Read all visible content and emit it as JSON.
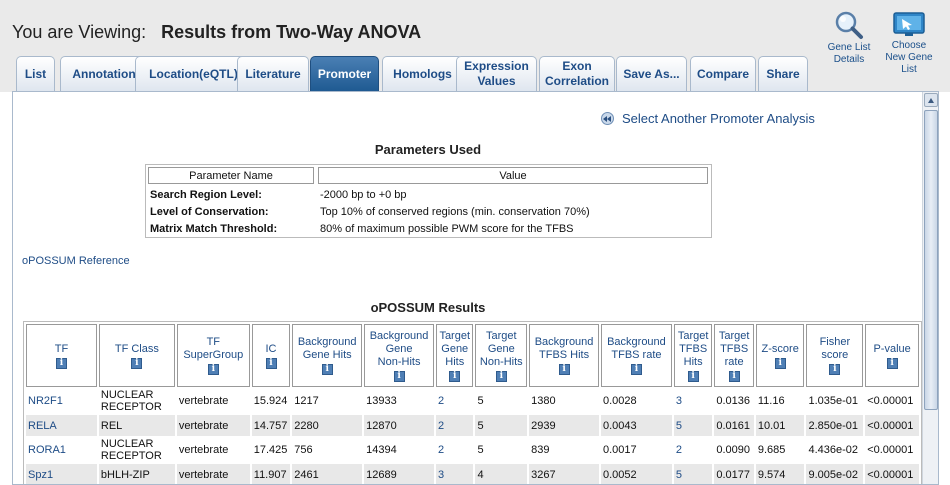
{
  "header": {
    "viewing_label": "You are Viewing:",
    "viewing_title": "Results from Two-Way ANOVA",
    "gene_list_details": [
      "Gene List",
      "Details"
    ],
    "choose_new_list": [
      "Choose",
      "New Gene",
      "List"
    ]
  },
  "tabs": [
    {
      "label": "List",
      "lines": [
        "List"
      ],
      "active": false
    },
    {
      "label": "Annotation",
      "lines": [
        "Annotation"
      ],
      "active": false
    },
    {
      "label": "Location(eQTL)",
      "lines": [
        "Location(eQTL)"
      ],
      "active": false
    },
    {
      "label": "Literature",
      "lines": [
        "Literature"
      ],
      "active": false
    },
    {
      "label": "Promoter",
      "lines": [
        "Promoter"
      ],
      "active": true
    },
    {
      "label": "Homologs",
      "lines": [
        "Homologs"
      ],
      "active": false
    },
    {
      "label": "Expression Values",
      "lines": [
        "Expression",
        "Values"
      ],
      "active": false
    },
    {
      "label": "Exon Correlation",
      "lines": [
        "Exon",
        "Correlation"
      ],
      "active": false
    },
    {
      "label": "Save As...",
      "lines": [
        "Save As..."
      ],
      "active": false
    },
    {
      "label": "Compare",
      "lines": [
        "Compare"
      ],
      "active": false
    },
    {
      "label": "Share",
      "lines": [
        "Share"
      ],
      "active": false
    }
  ],
  "select_another": "Select Another Promoter Analysis",
  "parameters": {
    "title": "Parameters Used",
    "col_name": "Parameter Name",
    "col_value": "Value",
    "rows": [
      {
        "name": "Search Region Level:",
        "value": "-2000 bp to +0 bp"
      },
      {
        "name": "Level of Conservation:",
        "value": "Top 10% of conserved regions (min. conservation 70%)"
      },
      {
        "name": "Matrix Match Threshold:",
        "value": "80% of maximum possible PWM score for the TFBS"
      }
    ]
  },
  "opossum_reference": "oPOSSUM Reference",
  "results": {
    "title": "oPOSSUM Results",
    "columns": [
      [
        "TF"
      ],
      [
        "TF Class"
      ],
      [
        "TF",
        "SuperGroup"
      ],
      [
        "IC"
      ],
      [
        "Background",
        "Gene Hits"
      ],
      [
        "Background",
        "Gene",
        "Non-Hits"
      ],
      [
        "Target",
        "Gene",
        "Hits"
      ],
      [
        "Target",
        "Gene",
        "Non-Hits"
      ],
      [
        "Background",
        "TFBS Hits"
      ],
      [
        "Background",
        "TFBS rate"
      ],
      [
        "Target",
        "TFBS",
        "Hits"
      ],
      [
        "Target",
        "TFBS",
        "rate"
      ],
      [
        "Z-score"
      ],
      [
        "Fisher",
        "score"
      ],
      [
        "P-value"
      ]
    ],
    "rows": [
      {
        "tf": "NR2F1",
        "tf_class": [
          "NUCLEAR",
          "RECEPTOR"
        ],
        "supergroup": "vertebrate",
        "ic": "15.924",
        "bg_gene_hits": "1217",
        "bg_gene_nonhits": "13933",
        "tg_gene_hits": "2",
        "tg_gene_nonhits": "5",
        "bg_tfbs_hits": "1380",
        "bg_tfbs_rate": "0.0028",
        "tg_tfbs_hits": "3",
        "tg_tfbs_rate": "0.0136",
        "zscore": "11.16",
        "fisher": "1.035e-01",
        "pvalue": "<0.00001"
      },
      {
        "tf": "RELA",
        "tf_class": [
          "REL"
        ],
        "supergroup": "vertebrate",
        "ic": "14.757",
        "bg_gene_hits": "2280",
        "bg_gene_nonhits": "12870",
        "tg_gene_hits": "2",
        "tg_gene_nonhits": "5",
        "bg_tfbs_hits": "2939",
        "bg_tfbs_rate": "0.0043",
        "tg_tfbs_hits": "5",
        "tg_tfbs_rate": "0.0161",
        "zscore": "10.01",
        "fisher": "2.850e-01",
        "pvalue": "<0.00001"
      },
      {
        "tf": "RORA1",
        "tf_class": [
          "NUCLEAR",
          "RECEPTOR"
        ],
        "supergroup": "vertebrate",
        "ic": "17.425",
        "bg_gene_hits": "756",
        "bg_gene_nonhits": "14394",
        "tg_gene_hits": "2",
        "tg_gene_nonhits": "5",
        "bg_tfbs_hits": "839",
        "bg_tfbs_rate": "0.0017",
        "tg_tfbs_hits": "2",
        "tg_tfbs_rate": "0.0090",
        "zscore": "9.685",
        "fisher": "4.436e-02",
        "pvalue": "<0.00001"
      },
      {
        "tf": "Spz1",
        "tf_class": [
          "bHLH-ZIP"
        ],
        "supergroup": "vertebrate",
        "ic": "11.907",
        "bg_gene_hits": "2461",
        "bg_gene_nonhits": "12689",
        "tg_gene_hits": "3",
        "tg_gene_nonhits": "4",
        "bg_tfbs_hits": "3267",
        "bg_tfbs_rate": "0.0052",
        "tg_tfbs_hits": "5",
        "tg_tfbs_rate": "0.0177",
        "zscore": "9.574",
        "fisher": "9.005e-02",
        "pvalue": "<0.00001"
      }
    ]
  },
  "colors": {
    "tab_active": "#2a649c",
    "link": "#1e4c86",
    "header_bg": "#eaeaea",
    "alt_row": "#e8e8e8"
  }
}
